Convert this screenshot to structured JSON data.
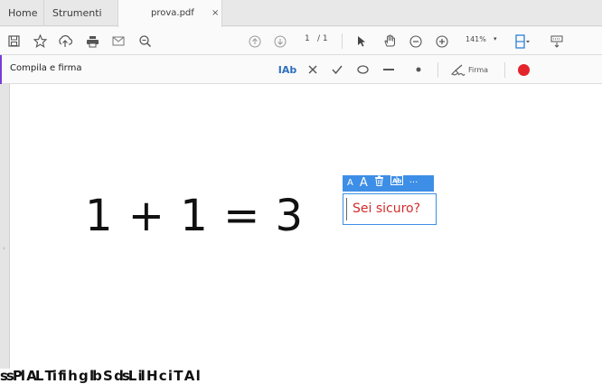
{
  "tabs": {
    "home": "Home",
    "tools": "Strumenti",
    "document": "prova.pdf",
    "close": "×"
  },
  "toolbar": {
    "page_current": "1",
    "page_total": "/ 1",
    "zoom": "141%",
    "icons": [
      "save-icon",
      "star-icon",
      "upload-icon",
      "print-icon",
      "mail-icon",
      "search-icon",
      "prev-page-icon",
      "next-page-icon",
      "select-icon",
      "hand-icon",
      "zoom-out-icon",
      "zoom-in-icon",
      "fit-icon",
      "keyboard-icon"
    ]
  },
  "fill_sign": {
    "title": "Compila e firma",
    "text_tool": "IAb",
    "firma_label": "Firma",
    "color_swatch": "#e3242b",
    "accent": "#7a3bd6"
  },
  "document": {
    "equation": "1 + 1 = 3"
  },
  "annotation": {
    "text": "Sei sicuro?",
    "toolbar": {
      "small_a": "A",
      "large_a": "A",
      "more": "···"
    },
    "accent": "#3d8ee6"
  },
  "bottom_strip": {
    "text": "ssPl  AL   Ti fi  h   g lb  S     dsL   il H  c  i   T   A  l  "
  }
}
